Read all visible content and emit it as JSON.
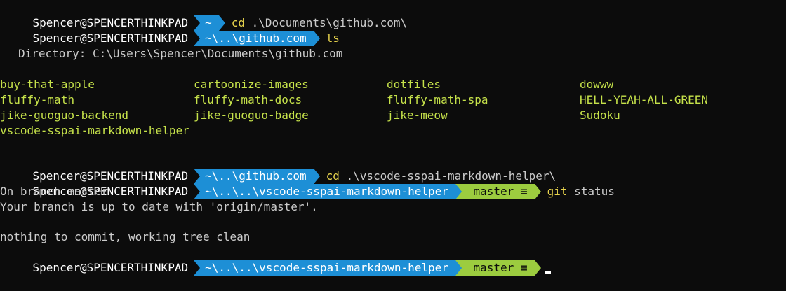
{
  "session": {
    "host": "Spencer@SPENCERTHINKPAD",
    "colors": {
      "background": "#0c0c0c",
      "path_segment": "#1d8fd6",
      "git_segment": "#9ccc3f",
      "command": "#e8d44d",
      "ls_entry": "#c6e24a",
      "text": "#cccccc"
    }
  },
  "lines": [
    {
      "path": "~",
      "cmd": "cd",
      "args": ".\\Documents\\github.com\\"
    },
    {
      "path": "~\\..\\github.com",
      "cmd": "ls",
      "args": ""
    }
  ],
  "directory_label": "Directory: C:\\Users\\Spencer\\Documents\\github.com",
  "ls_entries": [
    "buy-that-apple",
    "cartoonize-images",
    "dotfiles",
    "dowww",
    "fluffy-math",
    "fluffy-math-docs",
    "fluffy-math-spa",
    "HELL-YEAH-ALL-GREEN",
    "jike-guoguo-backend",
    "jike-guoguo-badge",
    "jike-meow",
    "Sudoku",
    "vscode-sspai-markdown-helper"
  ],
  "cd2": {
    "path": "~\\..\\github.com",
    "cmd": "cd",
    "args": ".\\vscode-sspai-markdown-helper\\"
  },
  "git_prompt": {
    "path": "~\\..\\..\\vscode-sspai-markdown-helper",
    "branch_icon": "",
    "branch": "master",
    "status_icon": "≡",
    "cmd": "git",
    "args": "status"
  },
  "git_output": [
    "On branch master",
    "Your branch is up to date with 'origin/master'.",
    "",
    "nothing to commit, working tree clean"
  ],
  "last_prompt": {
    "path": "~\\..\\..\\vscode-sspai-markdown-helper",
    "branch_icon": "",
    "branch": "master",
    "status_icon": "≡"
  }
}
